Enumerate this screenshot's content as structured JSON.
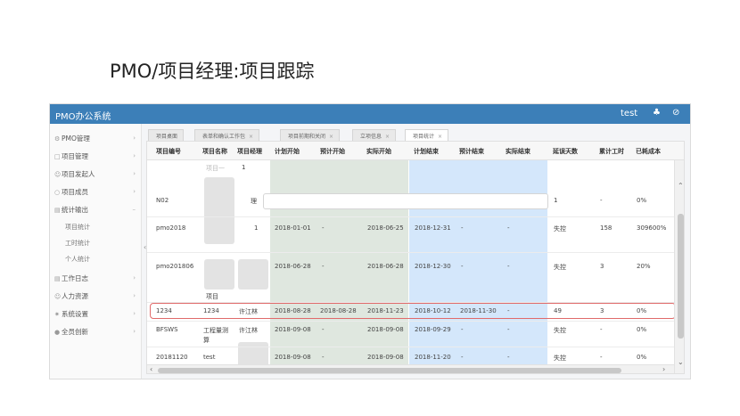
{
  "slide_title": "PMO/项目经理:项目跟踪",
  "app": {
    "title": "PMO办公系统",
    "user": "test"
  },
  "sidebar": {
    "items": [
      {
        "label": "PMO管理"
      },
      {
        "label": "项目管理"
      },
      {
        "label": "项目发起人"
      },
      {
        "label": "项目成员"
      },
      {
        "label": "统计输出"
      },
      {
        "label": "工作日志"
      },
      {
        "label": "人力资源"
      },
      {
        "label": "系统设置"
      },
      {
        "label": "全员创新"
      }
    ],
    "subitems": [
      {
        "label": "项目统计"
      },
      {
        "label": "工时统计"
      },
      {
        "label": "个人统计"
      }
    ]
  },
  "tabs": [
    {
      "label": "项目桌面"
    },
    {
      "label": "表单和确认工作包"
    },
    {
      "label": "项目前期和关闭"
    },
    {
      "label": "立项信息"
    },
    {
      "label": "项目统计"
    }
  ],
  "table": {
    "headers": [
      "项目编号",
      "项目名称",
      "项目经理",
      "计划开始",
      "预计开始",
      "实际开始",
      "计划结束",
      "预计结束",
      "实际结束",
      "延误天数",
      "累计工时",
      "已耗成本"
    ],
    "filter_placeholder": "项目一",
    "filter_value": "1",
    "rows": [
      [
        "N02",
        "",
        "理",
        "",
        "",
        "",
        "",
        "",
        "",
        "1",
        "-",
        "0%"
      ],
      [
        "pmo2018",
        "",
        "1",
        "2018-01-01",
        "-",
        "2018-06-25",
        "2018-12-31",
        "-",
        "-",
        "失控",
        "158",
        "309600%"
      ],
      [
        "pmo201806",
        "项目",
        "",
        "2018-06-28",
        "-",
        "2018-06-28",
        "2018-12-30",
        "-",
        "-",
        "失控",
        "3",
        "20%"
      ],
      [
        "1234",
        "1234",
        "许江林",
        "2018-08-28",
        "2018-08-28",
        "2018-11-23",
        "2018-10-12",
        "2018-11-30",
        "-",
        "49",
        "3",
        "0%"
      ],
      [
        "BFSWS",
        "工程量测算",
        "许江林",
        "2018-09-08",
        "-",
        "2018-09-08",
        "2018-09-29",
        "-",
        "-",
        "失控",
        "-",
        "0%"
      ],
      [
        "20181120",
        "test",
        "",
        "2018-09-08",
        "-",
        "2018-09-08",
        "2018-11-20",
        "-",
        "-",
        "失控",
        "-",
        "0%"
      ]
    ]
  },
  "colors": {
    "topbar": "#3c7fb8",
    "green_band": "#dfe7df",
    "blue_band": "#d4e7fb",
    "highlight": "#e06a6a"
  }
}
